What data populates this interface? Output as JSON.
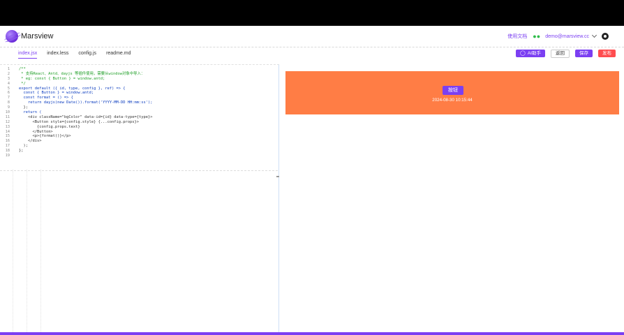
{
  "header": {
    "brand": "Marsview",
    "doc_link": "使用文档",
    "user_email": "demo@marsview.cc"
  },
  "tabs": [
    {
      "label": "index.jsx",
      "active": true
    },
    {
      "label": "index.less",
      "active": false
    },
    {
      "label": "config.js",
      "active": false
    },
    {
      "label": "readme.md",
      "active": false
    }
  ],
  "actions": {
    "ai_label": "AI助手",
    "back_label": "返回",
    "save_label": "保存",
    "publish_label": "发布"
  },
  "editor": {
    "line_numbers": [
      "1",
      "2",
      "3",
      "4",
      "5",
      "6",
      "7",
      "8",
      "9",
      "10",
      "11",
      "12",
      "13",
      "14",
      "15",
      "16",
      "17",
      "18",
      "19"
    ],
    "code_lines": [
      "/**",
      " * 支持React、Antd、dayjs 等插件使用，需要从window对象中导入：",
      " * eg: const { Button } = window.antd;",
      " */",
      "export default ({ id, type, config }, ref) => {",
      "  const { Button } = window.antd;",
      "  const format = () => {",
      "    return dayjs(new Date()).format('YYYY-MM-DD HH:mm:ss');",
      "  };",
      "  return (",
      "    <div className=\"bgColor\" data-id={id} data-type={type}>",
      "      <Button style={config.style} {...config.props}>",
      "        {config.props.text}",
      "      </Button>",
      "      <p>{format()}</p>",
      "    </div>",
      "  );",
      "};",
      ""
    ]
  },
  "preview": {
    "button_label": "按钮",
    "datetime": "2024-08-30 10:15:44"
  },
  "colors": {
    "accent": "#7b3ff2",
    "publish": "#ff4d4f",
    "preview_bg": "#ff7d45"
  }
}
